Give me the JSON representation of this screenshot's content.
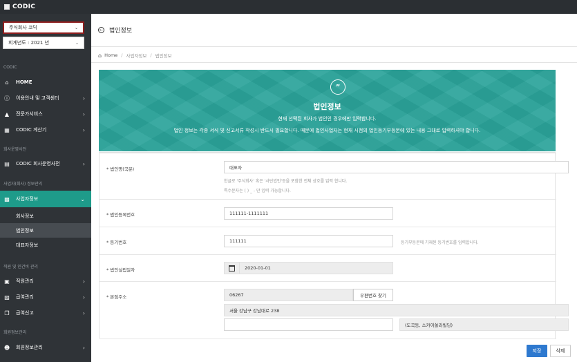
{
  "app": {
    "brand": "CODIC"
  },
  "sidebar": {
    "company_select": "주식회사 코딕",
    "year_select": "회계년도 : 2021 년",
    "section_codic": "CODIC",
    "items_main": [
      {
        "label": "HOME",
        "icon": "home-icon"
      },
      {
        "label": "이용안내 및 고객센터",
        "icon": "info-icon"
      },
      {
        "label": "전문가서비스",
        "icon": "graduation-cap-icon"
      },
      {
        "label": "CODIC 계산기",
        "icon": "calculator-icon"
      }
    ],
    "section_company": "회사운영사전",
    "item_company_dict": "CODIC 회사운영사전",
    "section_business": "사업자(회사) 정보관리",
    "item_business": "사업자정보",
    "sub_items": [
      "회사정보",
      "법인정보",
      "대표자정보"
    ],
    "section_hr": "직원 및 인건비 관리",
    "items_hr": [
      {
        "label": "직원관리",
        "icon": "id-card-icon"
      },
      {
        "label": "급여관리",
        "icon": "wallet-icon"
      },
      {
        "label": "급여신고",
        "icon": "copy-icon"
      }
    ],
    "section_member": "회원정보관리",
    "item_member": "회원정보관리"
  },
  "header": {
    "title": "법인정보"
  },
  "breadcrumb": {
    "home": "Home",
    "level1": "사업자정보",
    "level2": "법인정보"
  },
  "banner": {
    "title": "법인정보",
    "line1": "현재 선택된 회사가 법인인 경우에만 입력합니다.",
    "line2": "법인 정보는 각종 서식 및 신고서류 작성시 반드시 필요합니다. 때문에 법인사업자는 현재 시점의 법인등기부등본에 있는 내용 그대로 입력하셔야 합니다."
  },
  "form": {
    "corp_name": {
      "label": "법인명(국문)",
      "value": "대표자",
      "help1": "한글로 '주식회사' 혹은 '사단법인'등을 포함한 전체 상호를 입력 합니다.",
      "help2": "특수문자는 ( ) _ - 만 입력 가능합니다."
    },
    "corp_reg_no": {
      "label": "법인등록번호",
      "value": "111111-1111111"
    },
    "reg_no": {
      "label": "등기번호",
      "value": "111111",
      "help": "등기부등본에 기재된 등기번호를 입력합니다."
    },
    "established": {
      "label": "법인설립일자",
      "value": "2020-01-01"
    },
    "address": {
      "label": "본점주소",
      "zipcode": "06267",
      "find_button": "우편번호 찾기",
      "address1": "서울 강남구 강남대로 238",
      "address2": "",
      "extra": "(도곡동, 스카이쏠라빌딩)"
    }
  },
  "actions": {
    "save": "저장",
    "delete": "삭제"
  }
}
